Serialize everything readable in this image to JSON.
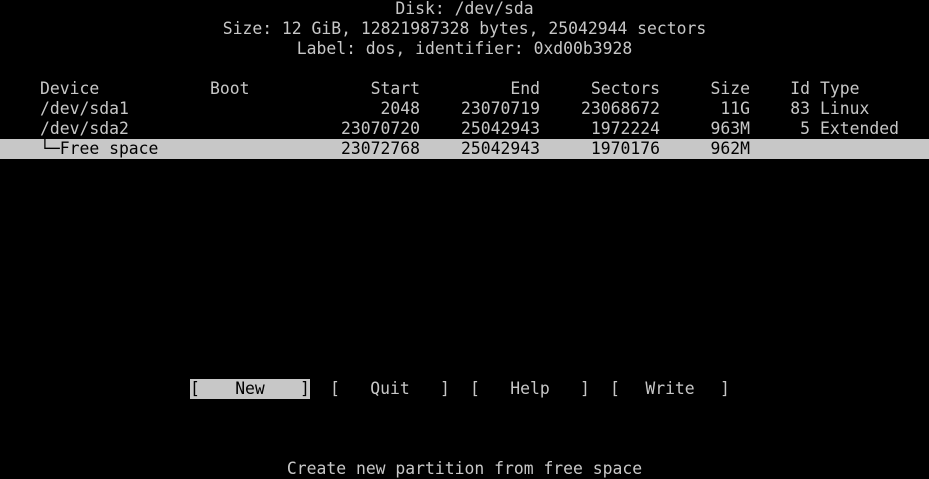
{
  "colors": {
    "background": "#000000",
    "foreground": "#c7c7c7",
    "highlight_background": "#c7c7c7",
    "highlight_foreground": "#000000"
  },
  "header": {
    "disk": "Disk: /dev/sda",
    "size": "Size: 12 GiB, 12821987328 bytes, 25042944 sectors",
    "label": "Label: dos, identifier: 0xd00b3928"
  },
  "table": {
    "columns": {
      "device": "Device",
      "boot": "Boot",
      "start": "Start",
      "end": "End",
      "sectors": "Sectors",
      "size": "Size",
      "id": "Id",
      "type": "Type"
    },
    "selection_marker": ">>",
    "rows": [
      {
        "device": "/dev/sda1",
        "boot": "",
        "start": "2048",
        "end": "23070719",
        "sectors": "23068672",
        "size": "11G",
        "id": "83",
        "type": "Linux"
      },
      {
        "device": "/dev/sda2",
        "boot": "",
        "start": "23070720",
        "end": "25042943",
        "sectors": "1972224",
        "size": "963M",
        "id": "5",
        "type": "Extended"
      },
      {
        "device": "└─Free space",
        "boot": "",
        "start": "23072768",
        "end": "25042943",
        "sectors": "1970176",
        "size": "962M",
        "id": "",
        "type": ""
      }
    ]
  },
  "menu": {
    "open_bracket": "[",
    "close_bracket": "]",
    "new": "New",
    "quit": "Quit",
    "help": "Help",
    "write": "Write",
    "selected": "new"
  },
  "status": {
    "hint": "Create new partition from free space"
  }
}
